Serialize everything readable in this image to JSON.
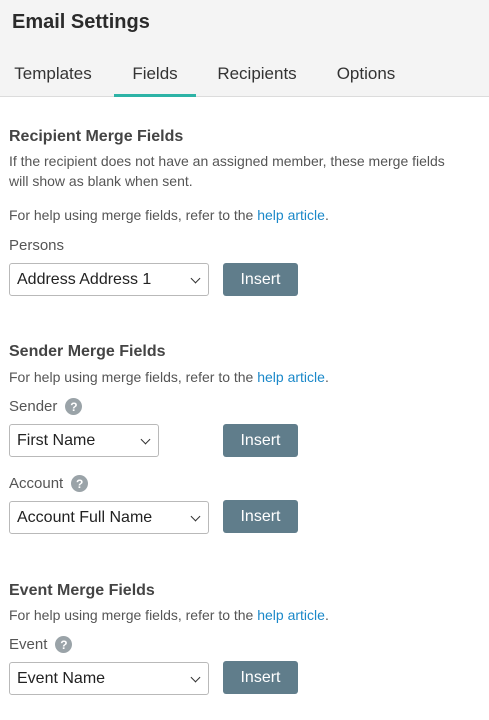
{
  "header": {
    "title": "Email Settings",
    "tabs": [
      {
        "label": "Templates"
      },
      {
        "label": "Fields"
      },
      {
        "label": "Recipients"
      },
      {
        "label": "Options"
      }
    ],
    "active_tab": "Fields"
  },
  "recipient": {
    "title": "Recipient Merge Fields",
    "desc_line1": "If the recipient does not have an assigned member, these merge fields",
    "desc_line2": "will show as blank when sent.",
    "help_prefix": "For help using merge fields, refer to the ",
    "help_link": "help article",
    "help_suffix": ".",
    "persons_label": "Persons",
    "persons_value": "Address Address 1",
    "insert_label": "Insert"
  },
  "sender": {
    "title": "Sender Merge Fields",
    "help_prefix": "For help using merge fields, refer to the ",
    "help_link": "help article",
    "help_suffix": ".",
    "sender_label": "Sender",
    "sender_value": "First Name",
    "account_label": "Account",
    "account_value": "Account Full Name",
    "insert_label": "Insert"
  },
  "event": {
    "title": "Event Merge Fields",
    "help_prefix": "For help using merge fields, refer to the ",
    "help_link": "help article",
    "help_suffix": ".",
    "event_label": "Event",
    "event_value": "Event Name",
    "insert_label": "Insert"
  },
  "help_icon_glyph": "?",
  "colors": {
    "accent": "#2db3a6",
    "link": "#1a88c9",
    "button": "#607d8b"
  }
}
